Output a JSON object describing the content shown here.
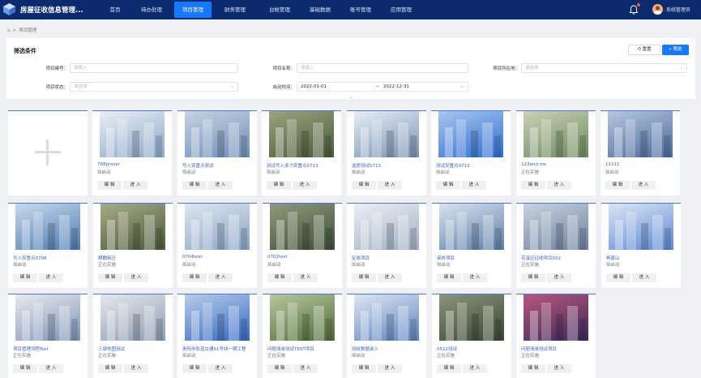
{
  "header": {
    "app_title": "房屋征收信息管理...",
    "nav": [
      "首页",
      "待办处理",
      "项目管理",
      "财务管理",
      "台帐管理",
      "基础数据",
      "账号管理",
      "应用管理"
    ],
    "active_nav": "项目管理",
    "user_name": "系统管理员"
  },
  "breadcrumb": {
    "home_icon": "home-icon",
    "separator": ">",
    "current": "项目管理"
  },
  "filter": {
    "title": "筛选条件",
    "reset_label": "重置",
    "filter_label": "筛选",
    "fields": {
      "project_no": {
        "label": "项目编号：",
        "placeholder": "请输入"
      },
      "project_name": {
        "label": "项目名称：",
        "placeholder": "请输入"
      },
      "region": {
        "label": "项目所在地：",
        "placeholder": "请选择"
      },
      "status": {
        "label": "项目状态：",
        "placeholder": "请选择"
      },
      "start_time": {
        "label": "启动时间：",
        "from": "2022-01-01",
        "arrow": "→",
        "to": "2022-12-31"
      }
    }
  },
  "projects": [
    {
      "name": "768prover",
      "status": "拟启动",
      "edit": "编 辑",
      "enter": "进 入"
    },
    {
      "name": "写入安置点测试",
      "status": "拟启动",
      "edit": "编 辑",
      "enter": "进 入"
    },
    {
      "name": "测试写入多个安置点0713",
      "status": "拟启动",
      "edit": "编 辑",
      "enter": "进 入"
    },
    {
      "name": "选房测试0713",
      "status": "拟启动",
      "edit": "编 辑",
      "enter": "进 入"
    },
    {
      "name": "测试安置点0713",
      "status": "拟启动",
      "edit": "编 辑",
      "enter": "进 入"
    },
    {
      "name": "123and me",
      "status": "正在实施",
      "edit": "编 辑",
      "enter": "进 入"
    },
    {
      "name": "11111",
      "status": "拟启动",
      "edit": "编 辑",
      "enter": "进 入"
    },
    {
      "name": "写入安置点0708",
      "status": "拟启动",
      "edit": "编 辑",
      "enter": "进 入"
    },
    {
      "name": "麒麟拆迁",
      "status": "正在实施",
      "edit": "编 辑",
      "enter": "进 入"
    },
    {
      "name": "0704test",
      "status": "拟启动",
      "edit": "编 辑",
      "enter": "进 入"
    },
    {
      "name": "0702test",
      "status": "拟启动",
      "edit": "编 辑",
      "enter": "进 入"
    },
    {
      "name": "征收项目",
      "status": "拟启动",
      "edit": "编 辑",
      "enter": "进 入"
    },
    {
      "name": "审核项目",
      "status": "拟启动",
      "edit": "编 辑",
      "enter": "进 入"
    },
    {
      "name": "花溪区征收项目002",
      "status": "正在实施",
      "edit": "编 辑",
      "enter": "进 入"
    },
    {
      "name": "杨家山",
      "status": "拟启动",
      "edit": "编 辑",
      "enter": "进 入"
    },
    {
      "name": "项目管理流程Test",
      "status": "正在实施",
      "edit": "编 辑",
      "enter": "进 入"
    },
    {
      "name": "三墩地图测试",
      "status": "正在实施",
      "edit": "编 辑",
      "enter": "进 入"
    },
    {
      "name": "贵阳市轨道交通S1号线一期工程",
      "status": "拟启动",
      "edit": "编 辑",
      "enter": "进 入"
    },
    {
      "name": "问题清单测试TEST项目",
      "status": "正在实施",
      "edit": "编 辑",
      "enter": "进 入"
    },
    {
      "name": "测绘数据录入",
      "status": "拟启动",
      "edit": "编 辑",
      "enter": "进 入"
    },
    {
      "name": "0512测试",
      "status": "正在实施",
      "edit": "编 辑",
      "enter": "进 入"
    },
    {
      "name": "问题清单测试项目",
      "status": "正在实施",
      "edit": "编 辑",
      "enter": "进 入"
    }
  ],
  "colors": {
    "header_bg": "#0c2a6e",
    "accent": "#1677ff",
    "link": "#3a66c9"
  }
}
